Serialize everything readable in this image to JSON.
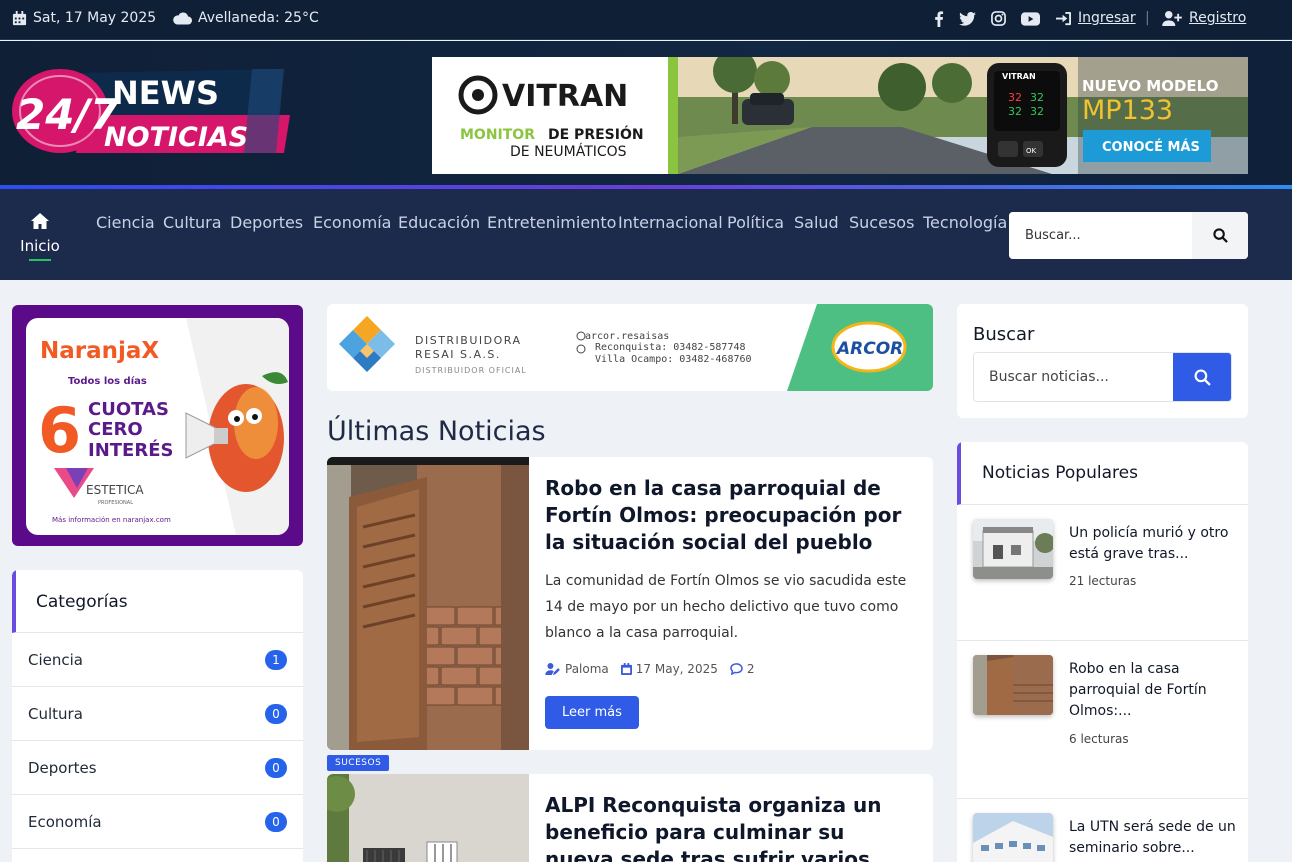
{
  "topbar": {
    "date": "Sat, 17 May 2025",
    "weather": "Avellaneda: 25°C",
    "login": "Ingresar",
    "separator": "|",
    "register": "Registro"
  },
  "logo": {
    "line1": "NEWS",
    "line2": "NOTICIAS",
    "mark": "24/7"
  },
  "header_ad": {
    "brand": "VITRAN",
    "line1": "MONITOR DE PRESIÓN",
    "line1_prefix": "MONITOR",
    "line1_suffix": "DE PRESIÓN",
    "line2": "DE NEUMÁTICOS",
    "headline": "NUEVO MODELO",
    "model": "MP133",
    "cta": "CONOCÉ MÁS",
    "device_brand": "VITRAN",
    "device_readings": [
      "32",
      "32",
      "32",
      "32"
    ],
    "device_label": "OK"
  },
  "nav": {
    "home": "Inicio",
    "items": [
      "Ciencia",
      "Cultura",
      "Deportes",
      "Economía",
      "Educación",
      "Entretenimiento",
      "Internacional",
      "Política",
      "Salud",
      "Sucesos",
      "Tecnología"
    ],
    "search_placeholder": "Buscar..."
  },
  "promo": {
    "brand": "NaranjaX",
    "days": "Todos los días",
    "number": "6",
    "text1": "CUOTAS",
    "text2": "CERO",
    "text3": "INTERÉS",
    "partner": "ESTETICA",
    "partner_sub": "PROFESIONAL",
    "footer": "Más información en naranjax.com"
  },
  "categories": {
    "title": "Categorías",
    "items": [
      {
        "name": "Ciencia",
        "count": "1"
      },
      {
        "name": "Cultura",
        "count": "0"
      },
      {
        "name": "Deportes",
        "count": "0"
      },
      {
        "name": "Economía",
        "count": "0"
      }
    ]
  },
  "center_ad": {
    "company1": "DISTRIBUIDORA",
    "company2": "RESAI S.A.S.",
    "company3": "DISTRIBUIDOR OFICIAL",
    "social": "arcor.resaisas",
    "phone1": "Reconquista: 03482-587748",
    "phone2": "Villa Ocampo: 03482-468760",
    "brand": "ARCOR"
  },
  "latest": {
    "title": "Últimas Noticias",
    "articles": [
      {
        "title": "Robo en la casa parroquial de Fortín Olmos: preocupación por la situación social del pueblo",
        "excerpt": "La comunidad de Fortín Olmos se vio sacudida este 14 de mayo por un hecho delictivo que tuvo como blanco a la casa parroquial.",
        "author": "Paloma",
        "date": "17 May, 2025",
        "comments": "2",
        "button": "Leer más"
      },
      {
        "tag": "SUCESOS",
        "title": "ALPI Reconquista organiza un beneficio para culminar su nueva sede tras sufrir varios robos"
      }
    ]
  },
  "sidebar_search": {
    "title": "Buscar",
    "placeholder": "Buscar noticias..."
  },
  "popular": {
    "title": "Noticias Populares",
    "items": [
      {
        "title": "Un policía murió y otro está grave tras...",
        "reads": "21 lecturas"
      },
      {
        "title": "Robo en la casa parroquial de Fortín Olmos:...",
        "reads": "6 lecturas"
      },
      {
        "title": "La UTN será sede de un seminario sobre...",
        "reads": ""
      }
    ]
  },
  "colors": {
    "accent": "#2f5be7",
    "nav_bg": "#1c2b4b",
    "header_bg": "#0f1f36",
    "brand_pink": "#d6166b"
  }
}
